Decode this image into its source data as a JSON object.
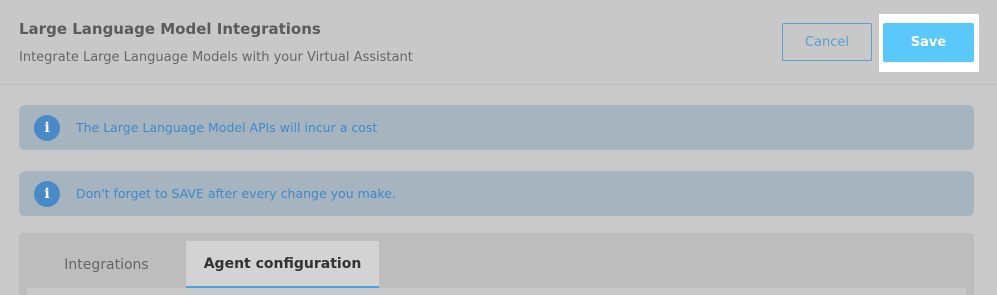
{
  "header": {
    "title": "Large Language Model Integrations",
    "subtitle": "Integrate Large Language Models with your Virtual Assistant",
    "cancel_label": "Cancel",
    "save_label": "Save"
  },
  "banners": [
    {
      "icon": "info-icon",
      "text": "The Large Language Model APIs will incur a cost"
    },
    {
      "icon": "info-icon",
      "text": "Don't forget to SAVE after every change you make."
    }
  ],
  "tabs": [
    {
      "label": "Integrations",
      "active": false
    },
    {
      "label": "Agent configuration",
      "active": true
    }
  ],
  "colors": {
    "accent": "#5ac8fa",
    "link_blue": "#3f88c9",
    "info_icon": "#4a89c8"
  }
}
